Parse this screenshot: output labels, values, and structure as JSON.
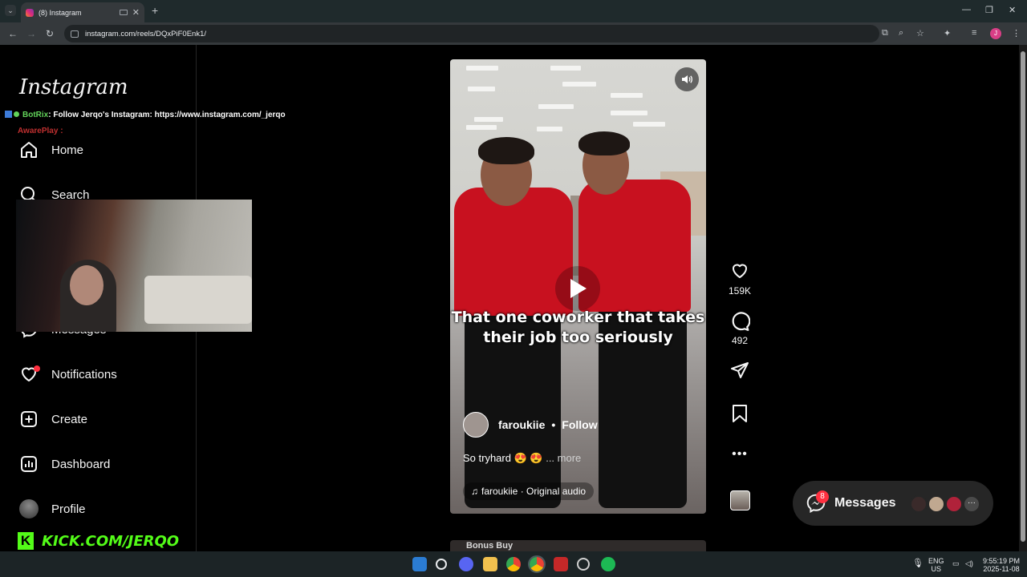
{
  "browser": {
    "tab_title": "(8) Instagram",
    "new_tab": "+",
    "tab_close": "✕",
    "url": "instagram.com/reels/DQxPiF0Enk1/",
    "profile_initial": "J",
    "window_min": "—",
    "window_restore": "❐",
    "window_close": "✕"
  },
  "sidebar": {
    "logo": "Instagram",
    "overlay_chat": [
      {
        "user": "BotRix",
        "text": ": Follow Jerqo's Instagram: https://www.instagram.com/_jerqo"
      },
      {
        "user": "AwarePlay",
        "text": ":"
      }
    ],
    "items": [
      {
        "label": "Home"
      },
      {
        "label": "Search"
      },
      {
        "label": "Messages"
      },
      {
        "label": "Notifications"
      },
      {
        "label": "Create"
      },
      {
        "label": "Dashboard"
      },
      {
        "label": "Profile"
      }
    ],
    "stream_banner": "KICK.COM/JERQO"
  },
  "reel": {
    "caption": "That one coworker that takes their job too seriously",
    "username": "faroukiie",
    "follow_label": "Follow",
    "description": "So tryhard 😍 😍",
    "more_label": "... more",
    "audio": "faroukiie · Original audio",
    "likes": "159K",
    "comments": "492",
    "next_reel_label": "Bonus Buy"
  },
  "messages_widget": {
    "label": "Messages",
    "badge": "8"
  },
  "taskbar": {
    "lang_top": "ENG",
    "lang_bottom": "US",
    "time": "9:55:19 PM",
    "date": "2025-11-08"
  }
}
